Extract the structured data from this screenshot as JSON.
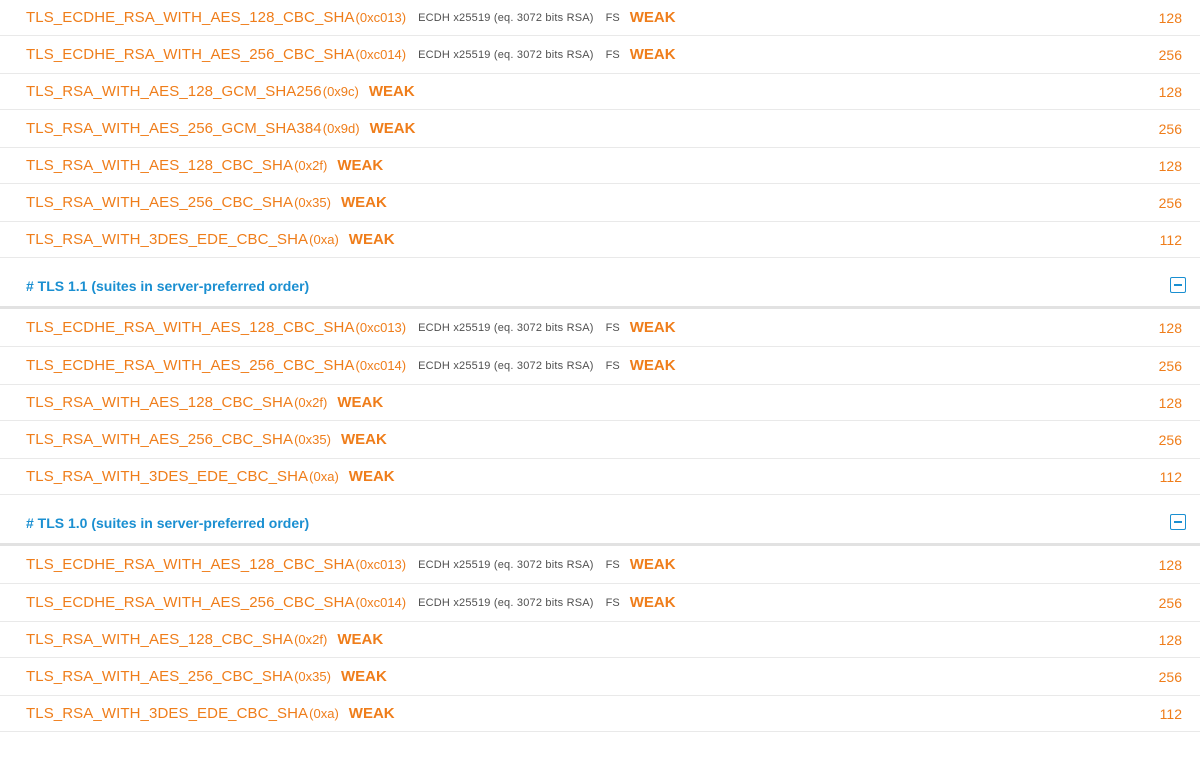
{
  "sections": [
    {
      "title": "",
      "rows": [
        {
          "suite": "TLS_ECDHE_RSA_WITH_AES_128_CBC_SHA",
          "code": "(0xc013)",
          "kex": "ECDH x25519 (eq. 3072 bits RSA)",
          "fs": "FS",
          "flag": "WEAK",
          "bits": "128"
        },
        {
          "suite": "TLS_ECDHE_RSA_WITH_AES_256_CBC_SHA",
          "code": "(0xc014)",
          "kex": "ECDH x25519 (eq. 3072 bits RSA)",
          "fs": "FS",
          "flag": "WEAK",
          "bits": "256"
        },
        {
          "suite": "TLS_RSA_WITH_AES_128_GCM_SHA256",
          "code": "(0x9c)",
          "kex": "",
          "fs": "",
          "flag": "WEAK",
          "bits": "128"
        },
        {
          "suite": "TLS_RSA_WITH_AES_256_GCM_SHA384",
          "code": "(0x9d)",
          "kex": "",
          "fs": "",
          "flag": "WEAK",
          "bits": "256"
        },
        {
          "suite": "TLS_RSA_WITH_AES_128_CBC_SHA",
          "code": "(0x2f)",
          "kex": "",
          "fs": "",
          "flag": "WEAK",
          "bits": "128"
        },
        {
          "suite": "TLS_RSA_WITH_AES_256_CBC_SHA",
          "code": "(0x35)",
          "kex": "",
          "fs": "",
          "flag": "WEAK",
          "bits": "256"
        },
        {
          "suite": "TLS_RSA_WITH_3DES_EDE_CBC_SHA",
          "code": "(0xa)",
          "kex": "",
          "fs": "",
          "flag": "WEAK",
          "bits": "112"
        }
      ]
    },
    {
      "title": "# TLS 1.1 (suites in server-preferred order)",
      "rows": [
        {
          "suite": "TLS_ECDHE_RSA_WITH_AES_128_CBC_SHA",
          "code": "(0xc013)",
          "kex": "ECDH x25519 (eq. 3072 bits RSA)",
          "fs": "FS",
          "flag": "WEAK",
          "bits": "128"
        },
        {
          "suite": "TLS_ECDHE_RSA_WITH_AES_256_CBC_SHA",
          "code": "(0xc014)",
          "kex": "ECDH x25519 (eq. 3072 bits RSA)",
          "fs": "FS",
          "flag": "WEAK",
          "bits": "256"
        },
        {
          "suite": "TLS_RSA_WITH_AES_128_CBC_SHA",
          "code": "(0x2f)",
          "kex": "",
          "fs": "",
          "flag": "WEAK",
          "bits": "128"
        },
        {
          "suite": "TLS_RSA_WITH_AES_256_CBC_SHA",
          "code": "(0x35)",
          "kex": "",
          "fs": "",
          "flag": "WEAK",
          "bits": "256"
        },
        {
          "suite": "TLS_RSA_WITH_3DES_EDE_CBC_SHA",
          "code": "(0xa)",
          "kex": "",
          "fs": "",
          "flag": "WEAK",
          "bits": "112"
        }
      ]
    },
    {
      "title": "# TLS 1.0 (suites in server-preferred order)",
      "rows": [
        {
          "suite": "TLS_ECDHE_RSA_WITH_AES_128_CBC_SHA",
          "code": "(0xc013)",
          "kex": "ECDH x25519 (eq. 3072 bits RSA)",
          "fs": "FS",
          "flag": "WEAK",
          "bits": "128"
        },
        {
          "suite": "TLS_ECDHE_RSA_WITH_AES_256_CBC_SHA",
          "code": "(0xc014)",
          "kex": "ECDH x25519 (eq. 3072 bits RSA)",
          "fs": "FS",
          "flag": "WEAK",
          "bits": "256"
        },
        {
          "suite": "TLS_RSA_WITH_AES_128_CBC_SHA",
          "code": "(0x2f)",
          "kex": "",
          "fs": "",
          "flag": "WEAK",
          "bits": "128"
        },
        {
          "suite": "TLS_RSA_WITH_AES_256_CBC_SHA",
          "code": "(0x35)",
          "kex": "",
          "fs": "",
          "flag": "WEAK",
          "bits": "256"
        },
        {
          "suite": "TLS_RSA_WITH_3DES_EDE_CBC_SHA",
          "code": "(0xa)",
          "kex": "",
          "fs": "",
          "flag": "WEAK",
          "bits": "112"
        }
      ]
    }
  ],
  "icons": {
    "collapse": "minus-square-icon"
  },
  "colors": {
    "suite_text": "#ef7d1a",
    "section_title": "#1a8fd1",
    "kex_text": "#505050",
    "row_divider": "#e9e9e9"
  }
}
